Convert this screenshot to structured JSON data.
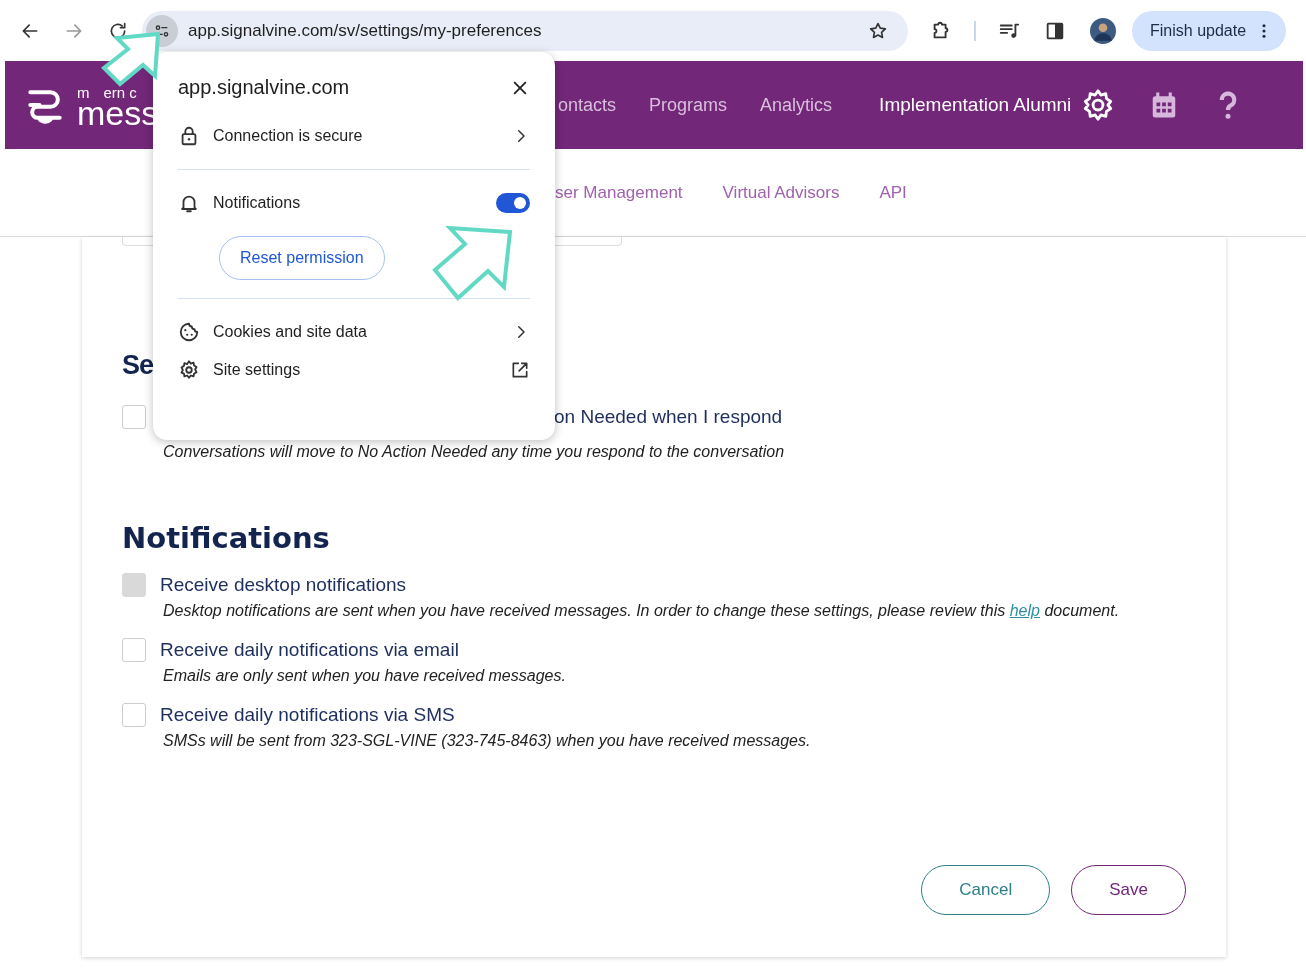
{
  "browser": {
    "url": "app.signalvine.com/sv/settings/my-preferences",
    "update_button": "Finish update"
  },
  "app_header": {
    "logo_tagline": [
      "m",
      "ern c"
    ],
    "logo_text": "mess",
    "nav": [
      "ontacts",
      "Programs",
      "Analytics"
    ],
    "account": "Implementation Alumni"
  },
  "subnav": [
    "ser Management",
    "Virtual Advisors",
    "API"
  ],
  "section_partial": {
    "heading": "Se",
    "option": {
      "label": "on Needed when I respond",
      "description": "Conversations will move to No Action Needed any time you respond to the conversation",
      "checked": false
    }
  },
  "notifications": {
    "heading": "Notifications",
    "options": [
      {
        "label": "Receive desktop notifications",
        "description": "Desktop notifications are sent when you have received messages. In order to change these settings, please review this",
        "link": "help",
        "description_end": "document.",
        "checked": false,
        "disabled": true
      },
      {
        "label": "Receive daily notifications via email",
        "description": "Emails are only sent when you have received messages.",
        "checked": false,
        "disabled": false
      },
      {
        "label": "Receive daily notifications via SMS",
        "description": "SMSs will be sent from 323-SGL-VINE (323-745-8463) when you have received messages.",
        "checked": false,
        "disabled": false
      }
    ]
  },
  "buttons": [
    {
      "kind": "cancel",
      "label": "Cancel"
    },
    {
      "kind": "save",
      "label": "Save"
    }
  ],
  "site_popup": {
    "site": "app.signalvine.com",
    "rows": [
      {
        "kind": "link",
        "label": "Connection is secure"
      },
      {
        "kind": "toggle",
        "label": "Notifications",
        "on": true,
        "action": "Reset permission"
      },
      {
        "kind": "link",
        "label": "Cookies and site data"
      },
      {
        "kind": "external",
        "label": "Site settings"
      }
    ]
  }
}
